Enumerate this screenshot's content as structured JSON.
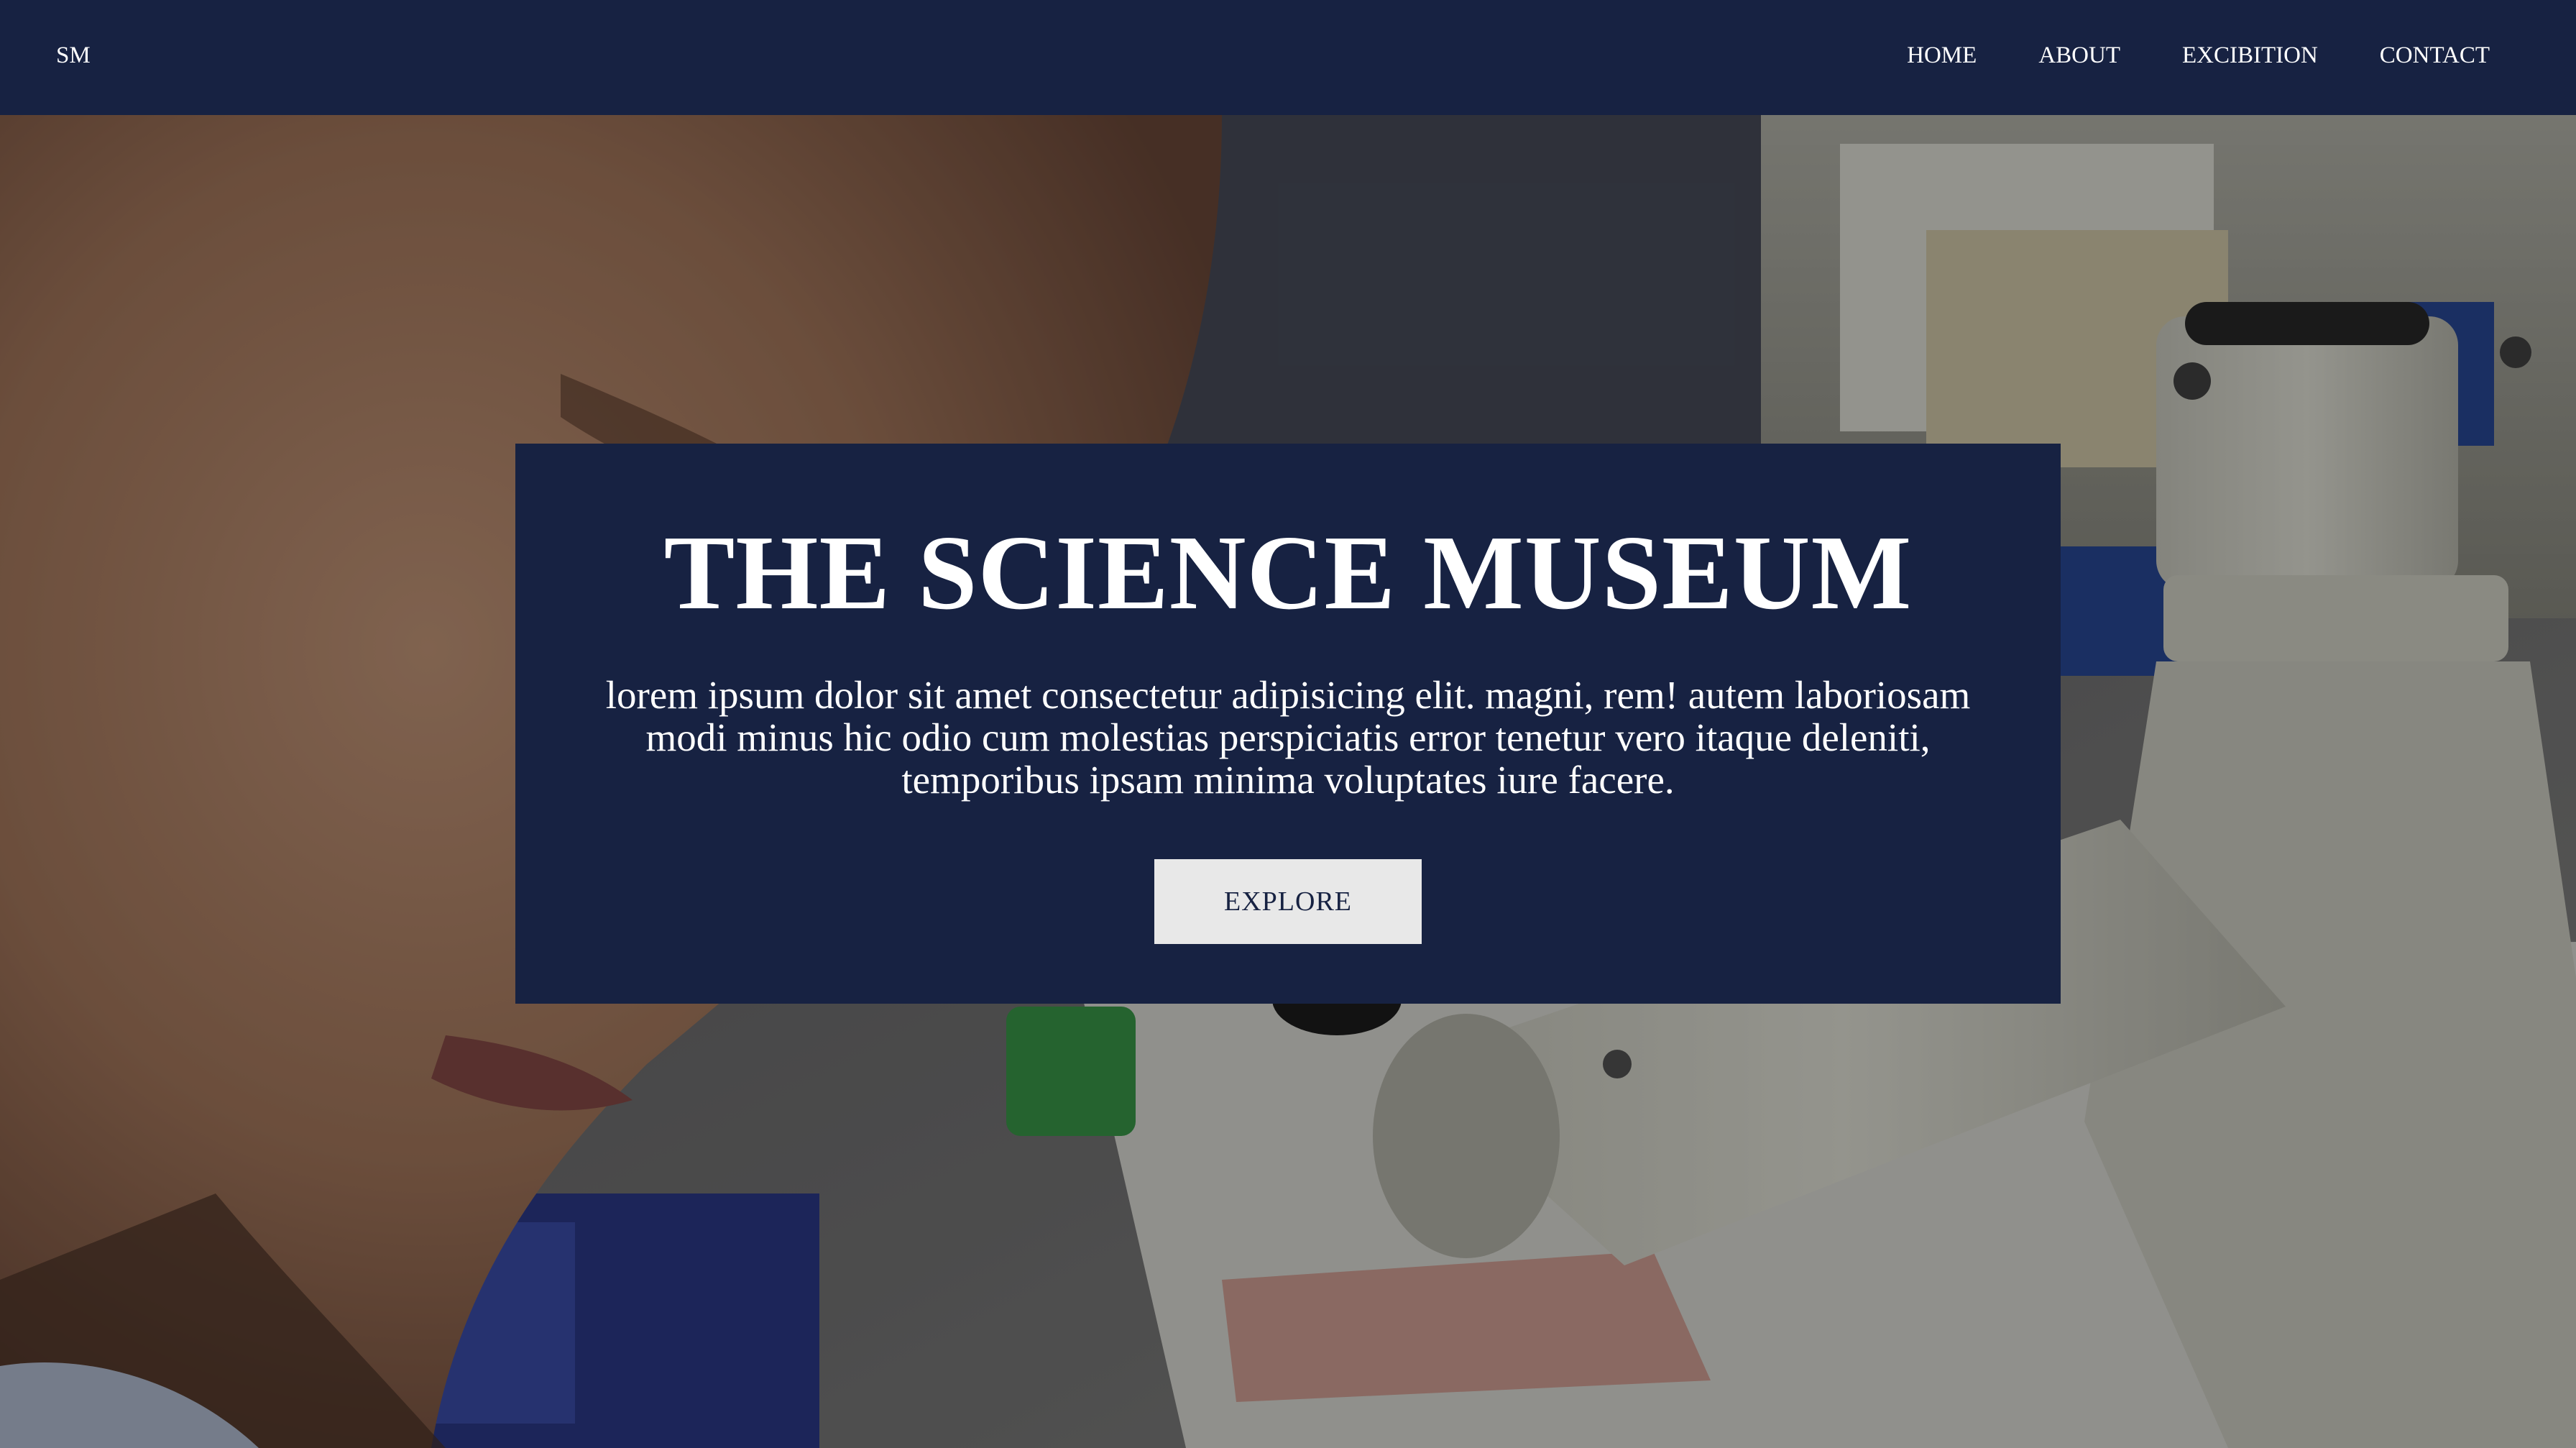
{
  "navbar": {
    "brand": "SM",
    "links": [
      {
        "label": "HOME"
      },
      {
        "label": "ABOUT"
      },
      {
        "label": "EXCIBITION"
      },
      {
        "label": "CONTACT"
      }
    ]
  },
  "hero": {
    "title": "THE SCIENCE MUSEUM",
    "description": "lorem ipsum dolor sit amet consectetur adipisicing elit. magni, rem! autem laboriosam modi minus hic odio cum molestias perspiciatis error tenetur vero itaque deleniti, temporibus ipsam minima voluptates iure facere.",
    "button_label": "EXPLORE"
  },
  "colors": {
    "navy": "#172242",
    "button_bg": "#e8e8e8",
    "text_light": "#ffffff"
  }
}
